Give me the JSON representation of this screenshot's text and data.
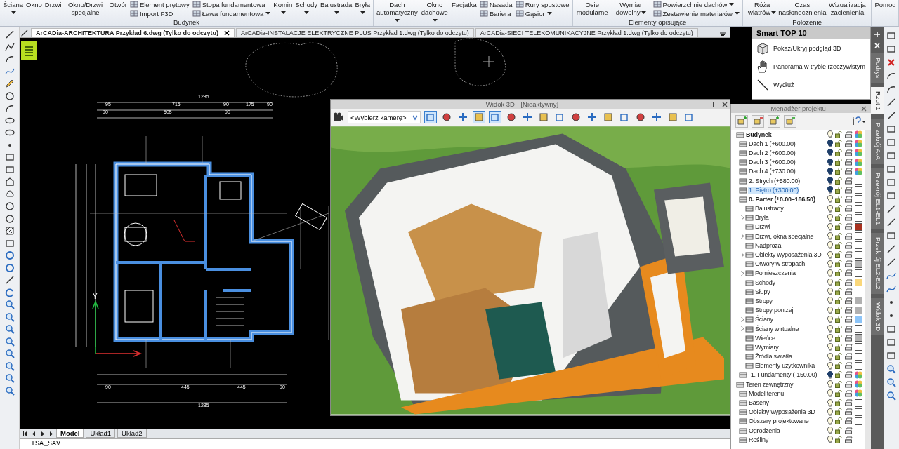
{
  "ribbon": {
    "groups": [
      {
        "label": "Budynek",
        "columns": [
          {
            "kind": "large",
            "label": "Ściana",
            "dropdown": true
          },
          {
            "kind": "large",
            "label": "Okno",
            "dropdown": false
          },
          {
            "kind": "large",
            "label": "Drzwi",
            "dropdown": false
          },
          {
            "kind": "large",
            "label": "Okno/Drzwi specjalne",
            "dropdown": false
          },
          {
            "kind": "large",
            "label": "Otwór",
            "dropdown": false
          },
          {
            "kind": "stack",
            "items": [
              {
                "label": "Element prętowy",
                "dropdown": false
              },
              {
                "label": "Import F3D",
                "dropdown": false
              }
            ]
          },
          {
            "kind": "stack",
            "items": [
              {
                "label": "Stopa fundamentowa",
                "dropdown": false
              },
              {
                "label": "Ława fundamentowa",
                "dropdown": true
              }
            ]
          },
          {
            "kind": "large",
            "label": "Komin",
            "dropdown": true
          },
          {
            "kind": "large",
            "label": "Schody",
            "dropdown": true
          },
          {
            "kind": "large",
            "label": "Balustrada",
            "dropdown": true
          },
          {
            "kind": "large",
            "label": "Bryła",
            "dropdown": true
          }
        ]
      },
      {
        "columns": [
          {
            "kind": "large",
            "label": "Dach automatyczny",
            "dropdown": true
          },
          {
            "kind": "large",
            "label": "Okno dachowe",
            "dropdown": true
          },
          {
            "kind": "large",
            "label": "Facjatka",
            "dropdown": false
          },
          {
            "kind": "stack",
            "items": [
              {
                "label": "Nasada",
                "dropdown": false
              },
              {
                "label": "Bariera",
                "dropdown": false
              }
            ]
          },
          {
            "kind": "stack",
            "items": [
              {
                "label": "Rury spustowe",
                "dropdown": false
              },
              {
                "label": "Gąsior",
                "dropdown": true
              }
            ]
          }
        ]
      },
      {
        "label": "Elementy opisujące",
        "columns": [
          {
            "kind": "large",
            "label": "Osie modularne",
            "dropdown": false
          },
          {
            "kind": "large",
            "label": "Wymiar dowolny",
            "dropdown": true
          },
          {
            "kind": "stack",
            "items": [
              {
                "label": "Powierzchnie dachów",
                "dropdown": true
              },
              {
                "label": "Zestawienie materiałów",
                "dropdown": true
              }
            ]
          }
        ]
      },
      {
        "label": "Położenie",
        "columns": [
          {
            "kind": "large",
            "label": "Róża wiatrów",
            "dropdown": true
          },
          {
            "kind": "large",
            "label": "Czas nasłonecznienia",
            "dropdown": false
          },
          {
            "kind": "large",
            "label": "Wizualizacja zacienienia",
            "dropdown": false
          }
        ]
      },
      {
        "columns": [
          {
            "kind": "large",
            "label": "Pomoc",
            "dropdown": false
          }
        ]
      }
    ]
  },
  "document_tabs": [
    {
      "label": "ArCADia-ARCHITEKTURA Przykład 6.dwg (Tylko do odczytu)",
      "selected": true
    },
    {
      "label": "ArCADia-INSTALACJE ELEKTRYCZNE PLUS Przykład 1.dwg (Tylko do odczytu)",
      "selected": false
    },
    {
      "label": "ArCADia-SIECI TELEKOMUNIKACYJNE Przykład 1.dwg (Tylko do odczytu)",
      "selected": false
    }
  ],
  "drawing": {
    "axis_label": "Y",
    "dimension_labels": [
      "1285",
      "95",
      "715",
      "90",
      "175",
      "90",
      "90",
      "505",
      "90",
      "90",
      "445",
      "445",
      "90",
      "1285"
    ]
  },
  "view_3d": {
    "title": "Widok 3D - [Nieaktywny]",
    "camera_select": "<Wybierz kamerę>",
    "toolbar_buttons": [
      {
        "pressed": true
      },
      {
        "pressed": false
      },
      {
        "pressed": false
      },
      {
        "pressed": true
      },
      {
        "pressed": true
      },
      {
        "pressed": false
      },
      {
        "pressed": false
      },
      {
        "pressed": false
      },
      {
        "pressed": false
      },
      {
        "pressed": false
      },
      {
        "pressed": false
      },
      {
        "pressed": false
      },
      {
        "pressed": false
      },
      {
        "pressed": false
      },
      {
        "pressed": false
      },
      {
        "pressed": false
      },
      {
        "pressed": false
      }
    ]
  },
  "layout_tabs": [
    {
      "label": "Model",
      "selected": true
    },
    {
      "label": "Układ1",
      "selected": false
    },
    {
      "label": "Układ2",
      "selected": false
    }
  ],
  "command_line": {
    "value": "ISA_SAV"
  },
  "smart_panel": {
    "title": "Smart TOP 10",
    "items": [
      {
        "kind": "cube",
        "label": "Pokaż/Ukryj podgląd 3D"
      },
      {
        "kind": "hand",
        "label": "Panorama w trybie rzeczywistym"
      },
      {
        "kind": "line",
        "label": "Wydłuż"
      }
    ]
  },
  "project_manager": {
    "title": "Menadżer projektu",
    "tree": [
      {
        "label": "Budynek",
        "bold": true,
        "expander": false,
        "selected": false,
        "light_on": true,
        "multicolor": true,
        "children": [
          {
            "label": "Dach 1 (+600.00)",
            "bold": false,
            "expander": false,
            "selected": false,
            "light_on": false,
            "multicolor": true
          },
          {
            "label": "Dach 2 (+600.00)",
            "bold": false,
            "expander": false,
            "selected": false,
            "light_on": false,
            "multicolor": true
          },
          {
            "label": "Dach 3 (+600.00)",
            "bold": false,
            "expander": false,
            "selected": false,
            "light_on": false,
            "multicolor": true
          },
          {
            "label": "Dach 4 (+730.00)",
            "bold": false,
            "expander": false,
            "selected": false,
            "light_on": false,
            "multicolor": true
          },
          {
            "label": "2. Strych (+580.00)",
            "bold": false,
            "expander": false,
            "selected": false,
            "light_on": false,
            "multicolor": false,
            "color": "#ffffff"
          },
          {
            "label": "1. Piętro (+300.00)",
            "bold": false,
            "expander": false,
            "selected": true,
            "light_on": false,
            "multicolor": false,
            "color": "#ffffff"
          },
          {
            "label": "0. Parter (±0.00–186.50)",
            "bold": true,
            "expander": false,
            "selected": false,
            "light_on": true,
            "multicolor": false,
            "color": "#ffffff",
            "children": [
              {
                "label": "Balustrady",
                "bold": false,
                "expander": false,
                "selected": false,
                "light_on": true,
                "multicolor": false,
                "color": "#ffffff"
              },
              {
                "label": "Bryła",
                "bold": false,
                "expander": true,
                "selected": false,
                "light_on": true,
                "multicolor": false,
                "color": "#ffffff"
              },
              {
                "label": "Drzwi",
                "bold": false,
                "expander": false,
                "selected": false,
                "light_on": true,
                "multicolor": false,
                "color": "#a83220"
              },
              {
                "label": "Drzwi, okna specjalne",
                "bold": false,
                "expander": true,
                "selected": false,
                "light_on": true,
                "multicolor": false,
                "color": "#ffffff"
              },
              {
                "label": "Nadproża",
                "bold": false,
                "expander": false,
                "selected": false,
                "light_on": true,
                "multicolor": false,
                "color": "#ffffff"
              },
              {
                "label": "Obiekty wyposażenia 3D",
                "bold": false,
                "expander": true,
                "selected": false,
                "light_on": true,
                "multicolor": false,
                "color": "#ffffff"
              },
              {
                "label": "Otwory w stropach",
                "bold": false,
                "expander": false,
                "selected": false,
                "light_on": true,
                "multicolor": false,
                "color": "#b4b4b4"
              },
              {
                "label": "Pomieszczenia",
                "bold": false,
                "expander": true,
                "selected": false,
                "light_on": true,
                "multicolor": false,
                "color": "#ffffff"
              },
              {
                "label": "Schody",
                "bold": false,
                "expander": false,
                "selected": false,
                "light_on": true,
                "multicolor": false,
                "color": "#fad77a"
              },
              {
                "label": "Słupy",
                "bold": false,
                "expander": false,
                "selected": false,
                "light_on": true,
                "multicolor": false,
                "color": "#ffffff"
              },
              {
                "label": "Stropy",
                "bold": false,
                "expander": false,
                "selected": false,
                "light_on": true,
                "multicolor": false,
                "color": "#b0b0b0"
              },
              {
                "label": "Stropy poniżej",
                "bold": false,
                "expander": false,
                "selected": false,
                "light_on": true,
                "multicolor": false,
                "color": "#b0b0b0"
              },
              {
                "label": "Ściany",
                "bold": false,
                "expander": true,
                "selected": false,
                "light_on": true,
                "multicolor": false,
                "color": "#8cc4f8"
              },
              {
                "label": "Ściany wirtualne",
                "bold": false,
                "expander": true,
                "selected": false,
                "light_on": true,
                "multicolor": false,
                "color": "#ffffff"
              },
              {
                "label": "Wieńce",
                "bold": false,
                "expander": false,
                "selected": false,
                "light_on": true,
                "multicolor": false,
                "color": "#b4b4b4"
              },
              {
                "label": "Wymiary",
                "bold": false,
                "expander": false,
                "selected": false,
                "light_on": true,
                "multicolor": false,
                "color": "#ffffff"
              },
              {
                "label": "Źródła światła",
                "bold": false,
                "expander": false,
                "selected": false,
                "light_on": true,
                "multicolor": false,
                "color": "#ffffff"
              },
              {
                "label": "Elementy użytkownika",
                "bold": false,
                "expander": false,
                "selected": false,
                "light_on": true,
                "multicolor": false,
                "color": "#ffffff"
              }
            ]
          },
          {
            "label": "-1. Fundamenty (-150.00)",
            "bold": false,
            "expander": false,
            "selected": false,
            "light_on": false,
            "multicolor": true
          }
        ]
      },
      {
        "label": "Teren zewnętrzny",
        "bold": false,
        "expander": false,
        "selected": false,
        "light_on": true,
        "multicolor": true,
        "children": [
          {
            "label": "Model terenu",
            "bold": false,
            "expander": false,
            "selected": false,
            "light_on": true,
            "multicolor": true
          },
          {
            "label": "Baseny",
            "bold": false,
            "expander": false,
            "selected": false,
            "light_on": true,
            "multicolor": false,
            "color": "#ffffff"
          },
          {
            "label": "Obiekty wyposażenia 3D",
            "bold": false,
            "expander": false,
            "selected": false,
            "light_on": true,
            "multicolor": false,
            "color": "#ffffff"
          },
          {
            "label": "Obszary projektowane",
            "bold": false,
            "expander": false,
            "selected": false,
            "light_on": true,
            "multicolor": false,
            "color": "#ffffff"
          },
          {
            "label": "Ogrodzenia",
            "bold": false,
            "expander": false,
            "selected": false,
            "light_on": true,
            "multicolor": false,
            "color": "#ffffff"
          },
          {
            "label": "Rośliny",
            "bold": false,
            "expander": false,
            "selected": false,
            "light_on": true,
            "multicolor": false,
            "color": "#ffffff"
          }
        ]
      }
    ]
  },
  "side_tabs": [
    {
      "label": "Podrys",
      "selected": false
    },
    {
      "label": "Rzut 1",
      "selected": true
    },
    {
      "label": "Przekrój A-A",
      "selected": false
    },
    {
      "label": "Przekrój EL1-EL1",
      "selected": false
    },
    {
      "label": "Przekrój EL2-EL2",
      "selected": false
    },
    {
      "label": "Widok 3D",
      "selected": false
    }
  ]
}
